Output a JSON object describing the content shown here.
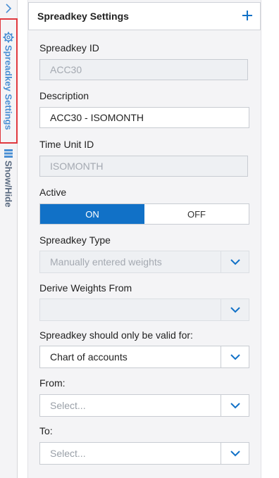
{
  "rail": {
    "settings_tab": "Spreadkey Settings",
    "showhide_tab": "Show/Hide"
  },
  "panel": {
    "title": "Spreadkey Settings",
    "fields": {
      "spreadkey_id": {
        "label": "Spreadkey ID",
        "value": "ACC30"
      },
      "description": {
        "label": "Description",
        "value": "ACC30 - ISOMONTH"
      },
      "time_unit_id": {
        "label": "Time Unit ID",
        "value": "ISOMONTH"
      },
      "active": {
        "label": "Active",
        "on_label": "ON",
        "off_label": "OFF",
        "selected": "ON"
      },
      "spreadkey_type": {
        "label": "Spreadkey Type",
        "value": "Manually entered weights"
      },
      "derive_weights": {
        "label": "Derive Weights From",
        "value": ""
      },
      "valid_for": {
        "label": "Spreadkey should only be valid for:",
        "value": "Chart of accounts"
      },
      "from": {
        "label": "From:",
        "placeholder": "Select..."
      },
      "to": {
        "label": "To:",
        "placeholder": "Select..."
      }
    }
  },
  "colors": {
    "accent": "#1171c7",
    "highlight_box": "#e0383e",
    "rail_tab_text": "#4a8fd4"
  },
  "icons": [
    "chevron-right-icon",
    "gear-icon",
    "list-icon",
    "plus-icon",
    "chevron-down-icon"
  ]
}
